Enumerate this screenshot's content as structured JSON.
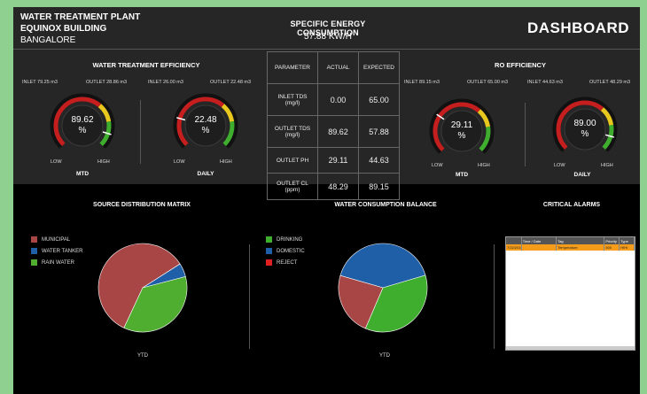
{
  "header": {
    "line1": "WATER TREATMENT PLANT",
    "line2": "EQUINOX BUILDING",
    "line3": "BANGALORE",
    "sec_title": "SPECIFIC ENERGY CONSUMPTION",
    "sec_value": "57.88 KW/H",
    "dashboard": "DASHBOARD"
  },
  "wte": {
    "title": "WATER TREATMENT EFFICIENCY",
    "mtd": {
      "inlet": "INLET  79.25 m3",
      "outlet": "OUTLET  28.86 m3",
      "value": "89.62",
      "unit": "%",
      "low": "LOW",
      "high": "HIGH",
      "name": "MTD",
      "fraction": 0.8962
    },
    "daily": {
      "inlet": "INLET  26.00 m3",
      "outlet": "OUTLET  22.48 m3",
      "value": "22.48",
      "unit": "%",
      "low": "LOW",
      "high": "HIGH",
      "name": "DAILY",
      "fraction": 0.2248
    }
  },
  "ro": {
    "title": "RO EFFICIENCY",
    "mtd": {
      "inlet": "INLET  89.15 m3",
      "outlet": "OUTLET  65.00 m3",
      "value": "29.11",
      "unit": "%",
      "low": "LOW",
      "high": "HIGH",
      "name": "MTD",
      "fraction": 0.2911
    },
    "daily": {
      "inlet": "INLET  44.63 m3",
      "outlet": "OUTLET  48.29 m3",
      "value": "89.00",
      "unit": "%",
      "low": "LOW",
      "high": "HIGH",
      "name": "DAILY",
      "fraction": 0.89
    }
  },
  "param_table": {
    "headers": [
      "PARAMETER",
      "ACTUAL",
      "EXPECTED"
    ],
    "rows": [
      {
        "name1": "INLET TDS",
        "name2": "(mg/l)",
        "actual": "0.00",
        "expected": "65.00"
      },
      {
        "name1": "OUTLET TDS",
        "name2": "(mg/l)",
        "actual": "89.62",
        "expected": "57.88"
      },
      {
        "name1": "OUTLET PH",
        "name2": "",
        "actual": "29.11",
        "expected": "44.63"
      },
      {
        "name1": "OUTLET CL",
        "name2": "(ppm)",
        "actual": "48.29",
        "expected": "89.15"
      }
    ]
  },
  "source": {
    "title": "SOURCE DISTRIBUTION MATRIX",
    "legend": [
      {
        "label": "MUNICIPAL",
        "color": "#a84646"
      },
      {
        "label": "WATER TANKER",
        "color": "#1f5fa8"
      },
      {
        "label": "RAIN WATER",
        "color": "#4fae2f"
      }
    ],
    "footer": "YTD"
  },
  "consumption": {
    "title": "WATER  CONSUMPTION BALANCE",
    "legend": [
      {
        "label": "DRINKING",
        "color": "#3fae2f"
      },
      {
        "label": "DOMESTIC",
        "color": "#1f5fa8"
      },
      {
        "label": "REJECT",
        "color": "#e02020"
      }
    ],
    "footer": "YTD"
  },
  "alarms": {
    "title": "CRITICAL ALARMS",
    "columns": [
      "Time / Date",
      "Tag",
      "Priority",
      "Type"
    ],
    "row": [
      "7/22/2016 5:02 PM",
      "Temperature",
      "500",
      "HIHI"
    ]
  },
  "chart_data": [
    {
      "type": "pie",
      "title": "SOURCE DISTRIBUTION MATRIX",
      "categories": [
        "MUNICIPAL",
        "WATER TANKER",
        "RAIN WATER"
      ],
      "values": [
        59,
        5,
        36
      ],
      "colors": [
        "#a84646",
        "#1f5fa8",
        "#4fae2f"
      ]
    },
    {
      "type": "pie",
      "title": "WATER  CONSUMPTION BALANCE",
      "categories": [
        "DRINKING",
        "DOMESTIC",
        "REJECT"
      ],
      "values": [
        36,
        41,
        23
      ],
      "colors": [
        "#3fae2f",
        "#1f5fa8",
        "#a84646"
      ]
    }
  ]
}
